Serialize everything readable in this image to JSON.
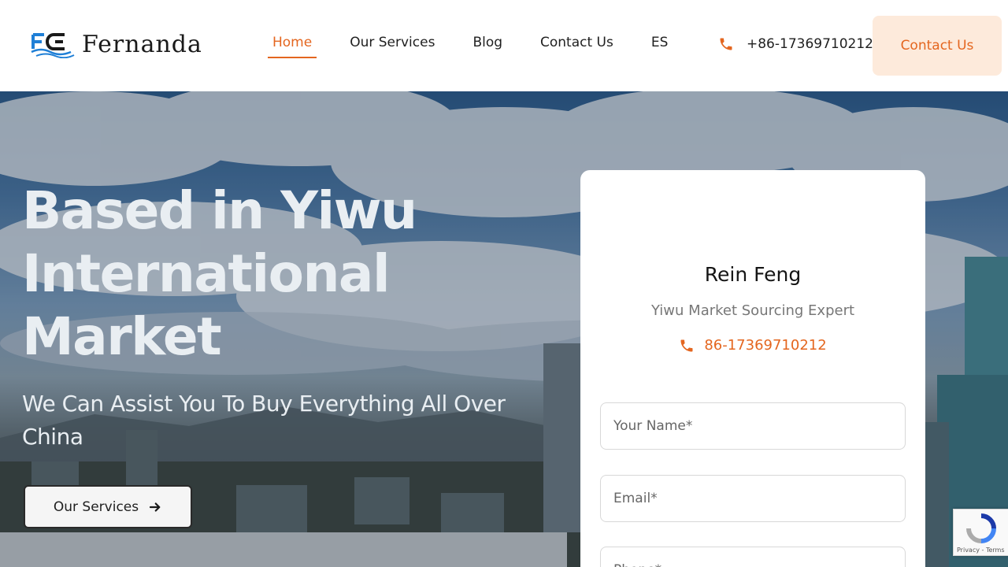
{
  "header": {
    "logo_text": "Fernanda",
    "nav": [
      {
        "label": "Home",
        "active": true
      },
      {
        "label": "Our Services",
        "active": false
      },
      {
        "label": "Blog",
        "active": false
      },
      {
        "label": "Contact Us",
        "active": false
      },
      {
        "label": "ES",
        "active": false
      }
    ],
    "phone": "+86-17369710212",
    "contact_button": "Contact Us"
  },
  "hero": {
    "title": "Based in Yiwu International Market",
    "subtitle": "We Can Assist You To Buy Everything All Over China",
    "button_label": "Our Services"
  },
  "card": {
    "name": "Rein Feng",
    "role": "Yiwu Market Sourcing Expert",
    "phone": "86-17369710212",
    "fields": {
      "name_placeholder": "Your Name*",
      "email_placeholder": "Email*",
      "phone_placeholder": "Phone*"
    }
  },
  "recaptcha": {
    "terms": "Privacy - Terms"
  },
  "colors": {
    "accent": "#e4661f",
    "accent_light": "#fdeadb",
    "logo_blue": "#1f7fd6"
  },
  "icons": {
    "phone": "phone-icon",
    "arrow": "arrow-right-icon",
    "recaptcha": "recaptcha-icon"
  }
}
